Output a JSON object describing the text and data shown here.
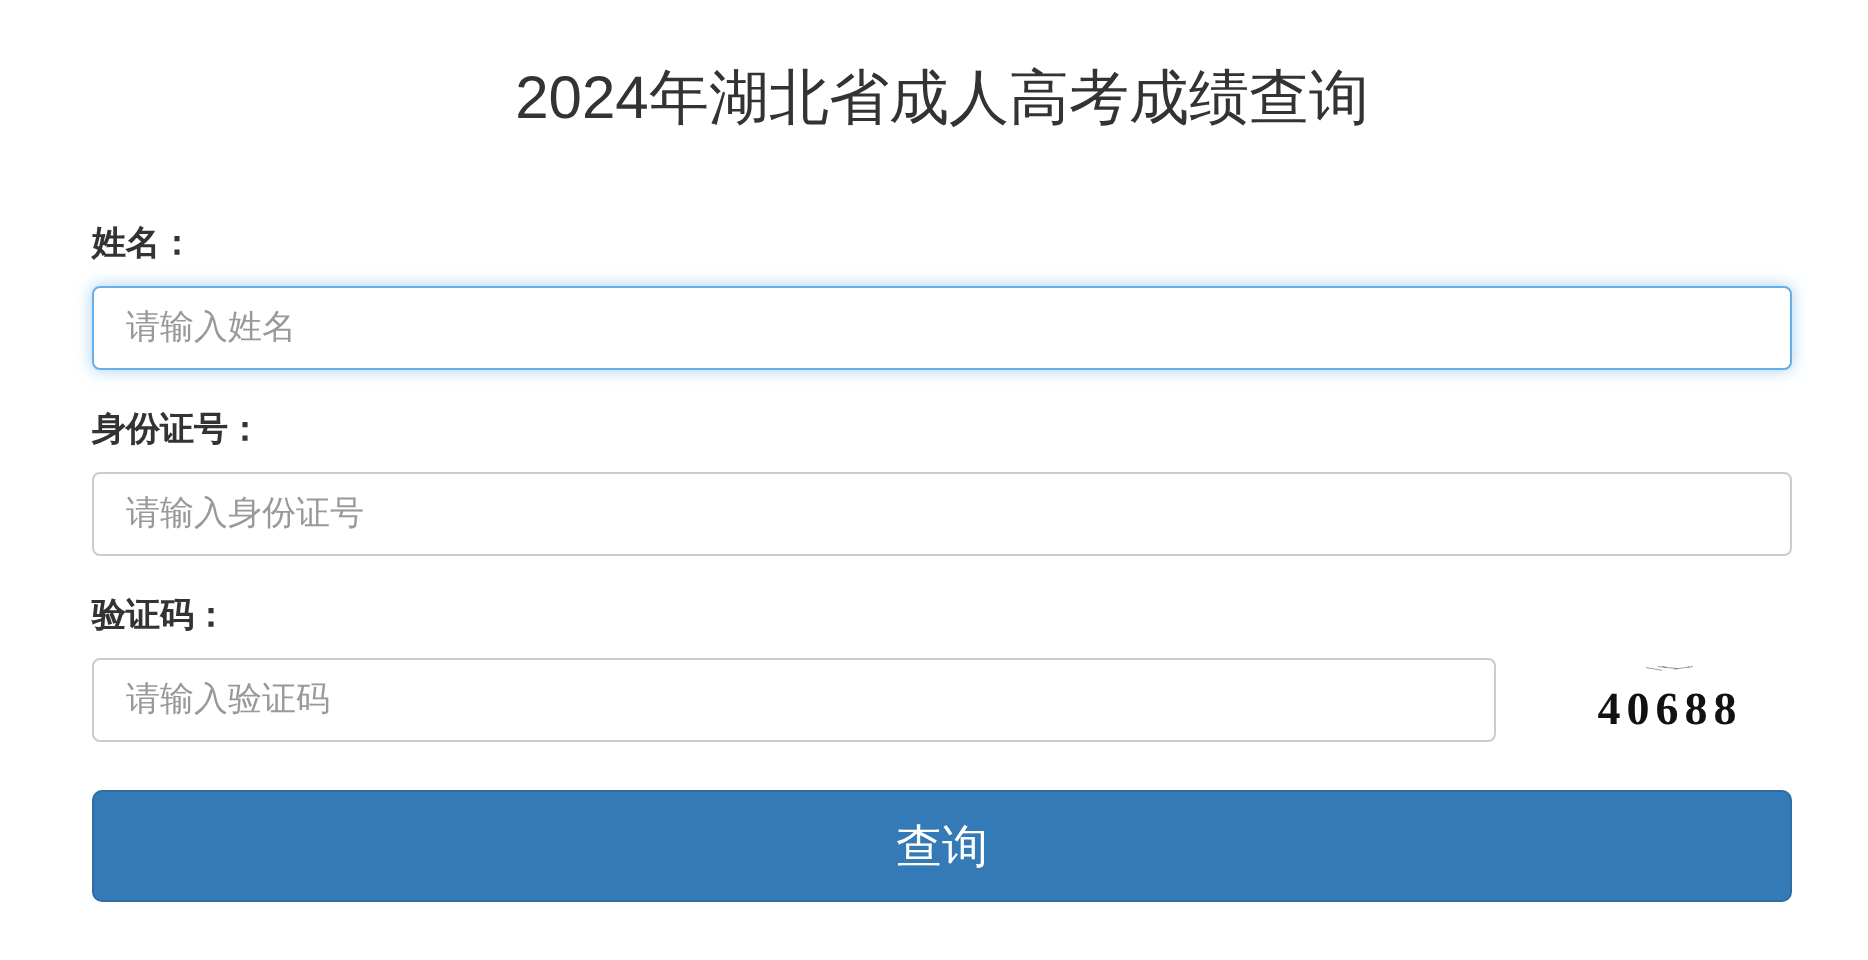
{
  "title": "2024年湖北省成人高考成绩查询",
  "fields": [
    {
      "label": "姓名：",
      "placeholder": "请输入姓名",
      "focused": true
    },
    {
      "label": "身份证号：",
      "placeholder": "请输入身份证号",
      "focused": false
    },
    {
      "label": "验证码：",
      "placeholder": "请输入验证码",
      "focused": false,
      "captcha": "40688"
    }
  ],
  "button": "查询"
}
